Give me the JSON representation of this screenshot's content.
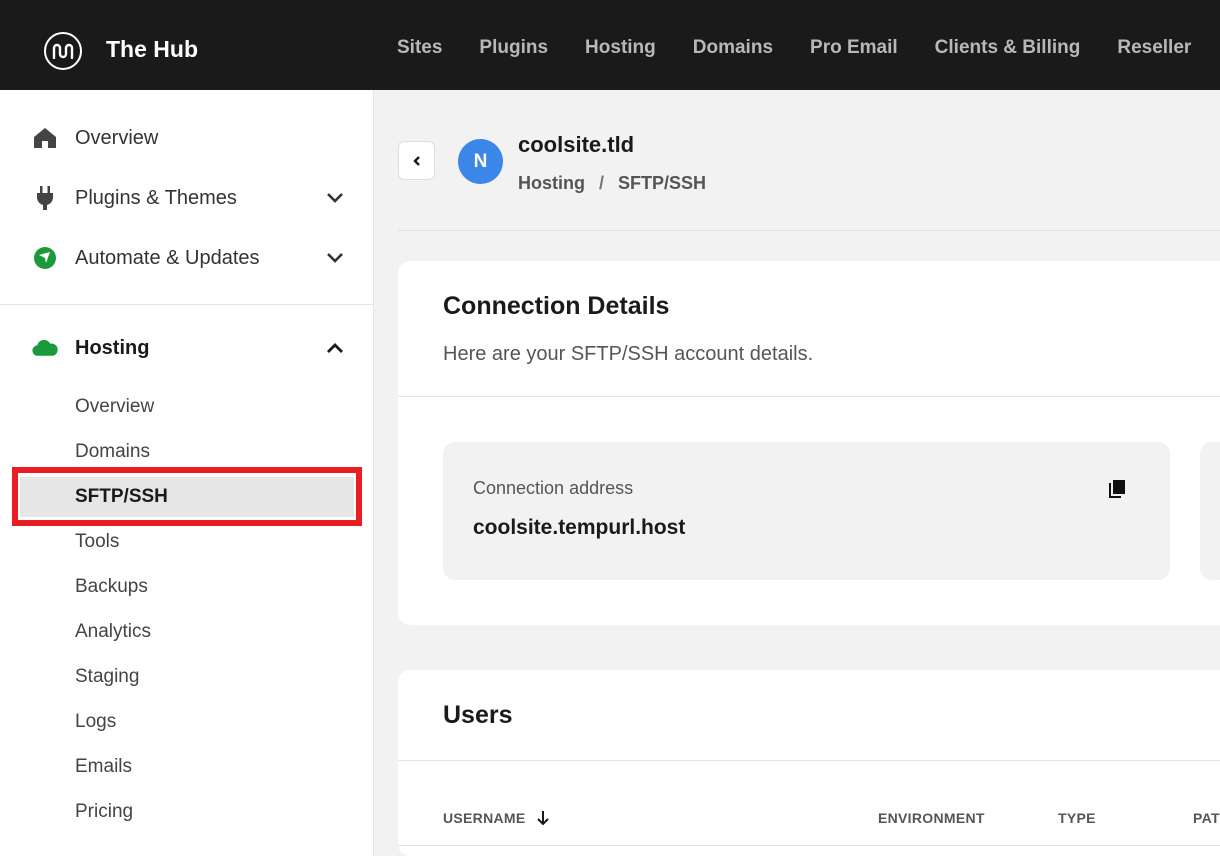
{
  "topbar": {
    "brand": "The Hub",
    "nav": [
      "Sites",
      "Plugins",
      "Hosting",
      "Domains",
      "Pro Email",
      "Clients & Billing",
      "Reseller"
    ]
  },
  "sidebar": {
    "items": [
      {
        "label": "Overview",
        "icon": "home-icon"
      },
      {
        "label": "Plugins & Themes",
        "icon": "plug-icon"
      },
      {
        "label": "Automate & Updates",
        "icon": "automate-icon"
      }
    ],
    "hosting": {
      "label": "Hosting",
      "icon": "cloud-icon",
      "subitems": [
        "Overview",
        "Domains",
        "SFTP/SSH",
        "Tools",
        "Backups",
        "Analytics",
        "Staging",
        "Logs",
        "Emails",
        "Pricing"
      ],
      "active": "SFTP/SSH"
    }
  },
  "header": {
    "avatar_letter": "N",
    "site_title": "coolsite.tld",
    "breadcrumb": [
      "Hosting",
      "SFTP/SSH"
    ],
    "breadcrumb_sep": "/"
  },
  "connection": {
    "title": "Connection Details",
    "subtitle": "Here are your SFTP/SSH account details.",
    "address_label": "Connection address",
    "address_value": "coolsite.tempurl.host"
  },
  "users": {
    "title": "Users",
    "columns": [
      "USERNAME",
      "ENVIRONMENT",
      "TYPE",
      "PAT"
    ]
  },
  "colors": {
    "topbar": "#1a1a1a",
    "accent_blue": "#3b86e6",
    "hosting_green": "#1a9a3a",
    "highlight_red": "#ea1c24"
  }
}
